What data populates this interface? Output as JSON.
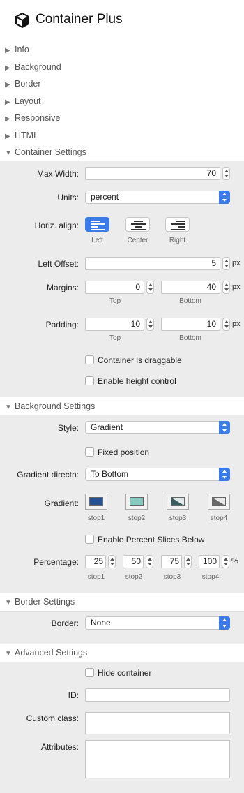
{
  "header": {
    "title": "Container Plus",
    "icon": "cube-icon"
  },
  "collapsed_sections": [
    "Info",
    "Background",
    "Border",
    "Layout",
    "Responsive",
    "HTML"
  ],
  "container_settings": {
    "heading": "Container Settings",
    "max_width_label": "Max Width:",
    "max_width": "70",
    "units_label": "Units:",
    "units": "percent",
    "horiz_align_label": "Horiz. align:",
    "align_left": "Left",
    "align_center": "Center",
    "align_right": "Right",
    "left_offset_label": "Left Offset:",
    "left_offset": "5",
    "px": "px",
    "margins_label": "Margins:",
    "margin_top": "0",
    "margin_bottom": "40",
    "padding_label": "Padding:",
    "padding_top": "10",
    "padding_bottom": "10",
    "top_label": "Top",
    "bottom_label": "Bottom",
    "draggable_label": "Container is draggable",
    "height_control_label": "Enable height control"
  },
  "background_settings": {
    "heading": "Background Settings",
    "style_label": "Style:",
    "style": "Gradient",
    "fixed_label": "Fixed position",
    "direction_label": "Gradient directn:",
    "direction": "To Bottom",
    "gradient_label": "Gradient:",
    "stops": [
      "stop1",
      "stop2",
      "stop3",
      "stop4"
    ],
    "stop_colors": [
      "#245394",
      "#86c9bf",
      "#3b5e60",
      "#6a6a6a"
    ],
    "percent_slices_label": "Enable Percent Slices Below",
    "percentage_label": "Percentage:",
    "percentages": [
      "25",
      "50",
      "75",
      "100"
    ],
    "percent_sign": "%"
  },
  "border_settings": {
    "heading": "Border Settings",
    "border_label": "Border:",
    "border": "None"
  },
  "advanced_settings": {
    "heading": "Advanced Settings",
    "hide_label": "Hide container",
    "id_label": "ID:",
    "id_value": "",
    "class_label": "Custom class:",
    "class_value": "",
    "attributes_label": "Attributes:",
    "attributes_value": ""
  },
  "colors": {
    "accent": "#3b7be8",
    "panel": "#ececec"
  }
}
